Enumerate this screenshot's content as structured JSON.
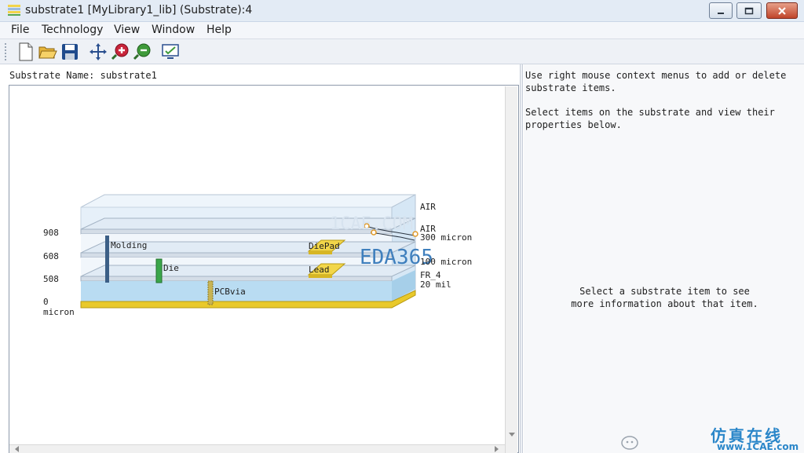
{
  "window": {
    "title": "substrate1 [MyLibrary1_lib] (Substrate):4"
  },
  "menu": {
    "items": [
      "File",
      "Technology",
      "View",
      "Window",
      "Help"
    ]
  },
  "toolbar": {
    "buttons": [
      "new-document-icon",
      "open-folder-icon",
      "save-icon",
      "pan-icon",
      "zoom-in-icon",
      "zoom-out-icon",
      "view-check-icon"
    ]
  },
  "substrate": {
    "name_label": "Substrate Name: substrate1"
  },
  "diagram": {
    "axis_labels": {
      "h908": "908",
      "h608": "608",
      "h508": "508",
      "h0": "0",
      "unit": "micron"
    },
    "layers": {
      "air_top": "AIR",
      "air_mid": "AIR",
      "thick_300": "300 micron",
      "thick_100": "100 micron",
      "fr4": "FR_4",
      "fr4_thick": "20 mil"
    },
    "items": {
      "molding": "Molding",
      "die": "Die",
      "diepad": "DiePad",
      "lead": "Lead",
      "pcbvia": "PCBvia"
    },
    "watermark": "EDA365",
    "watermark_ghost": "1CAE.COM"
  },
  "help": {
    "line1": "Use right mouse context menus to add or delete",
    "line2": "substrate items.",
    "line3": "Select items on the substrate and view their",
    "line4": "properties below.",
    "center1": "Select a substrate item to see",
    "center2": "more information about that item."
  },
  "watermark_bottom": {
    "text_cn": "仿真在线",
    "url": "www.1CAE.com"
  },
  "colors": {
    "layer_fill": "#e4effa",
    "fr4_fill": "#b9dcf2",
    "gold": "#e9c92a",
    "molding": "#3c5f86",
    "die": "#3aa64a",
    "via": "#c8b454"
  }
}
